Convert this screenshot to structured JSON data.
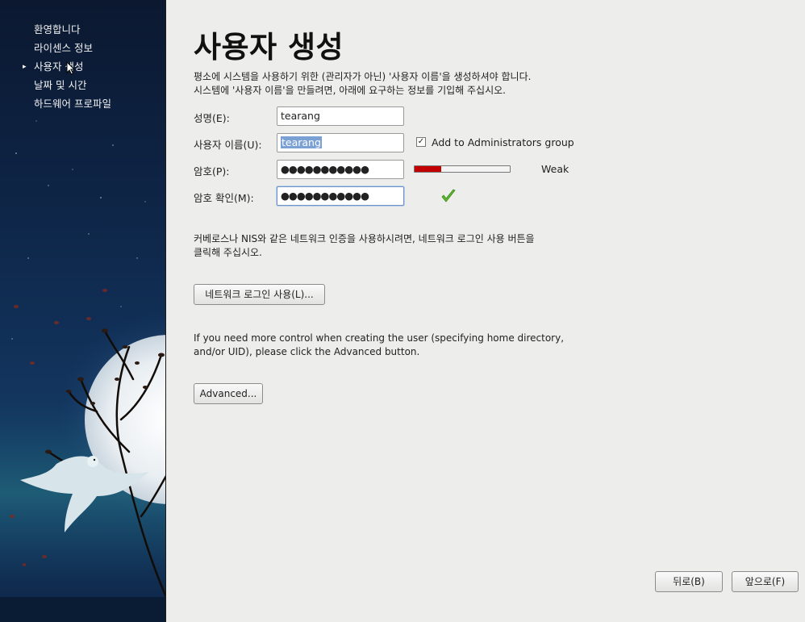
{
  "sidebar": {
    "items": [
      {
        "label": "환영합니다"
      },
      {
        "label": "라이센스 정보"
      },
      {
        "label": "사용자 생성"
      },
      {
        "label": "날짜 및 시간"
      },
      {
        "label": "하드웨어 프로파일"
      }
    ],
    "active_index": 2
  },
  "page": {
    "title": "사용자 생성",
    "intro_line1": "평소에 시스템을 사용하기 위한 (관리자가 아닌) '사용자 이름'을 생성하셔야 합니다.",
    "intro_line2": "시스템에 '사용자 이름'을 만들려면, 아래에 요구하는 정보를 기입해 주십시오."
  },
  "form": {
    "fullname_label": "성명(E):",
    "fullname_value": "tearang",
    "username_label": "사용자 이름(U):",
    "username_value": "tearang",
    "admin_checkbox_label": "Add to Administrators group",
    "admin_checked": true,
    "password_label": "암호(P):",
    "password_value": "●●●●●●●●●●●",
    "strength_label": "Weak",
    "strength_level": 0.28,
    "confirm_label": "암호 확인(M):",
    "confirm_value": "●●●●●●●●●●●"
  },
  "network": {
    "text_line1": "커베로스나 NIS와 같은 네트워크 인증을 사용하시려면, 네트워크 로그인 사용 버튼을",
    "text_line2": "클릭해 주십시오.",
    "button_label": "네트워크 로그인 사용(L)..."
  },
  "advanced": {
    "text_line1": "If you need more control when creating the user (specifying home directory,",
    "text_line2": "and/or UID), please click the Advanced button.",
    "button_label": "Advanced..."
  },
  "footer": {
    "back_label": "뒤로(B)",
    "forward_label": "앞으로(F)"
  },
  "colors": {
    "strength_weak": "#c20000",
    "check_ok": "#5cb82e",
    "selection": "#7aa0d4"
  }
}
